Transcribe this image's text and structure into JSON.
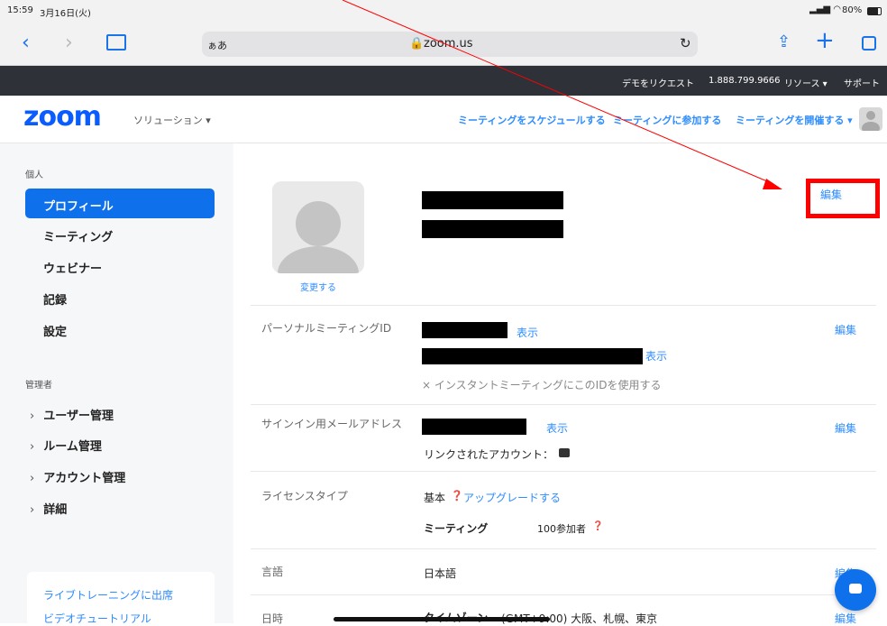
{
  "status_bar": {
    "time": "15:59",
    "date": "3月16日(火)",
    "battery": "80%"
  },
  "browser": {
    "text_size": "ぁあ",
    "url": "zoom.us"
  },
  "top_bar": {
    "request_demo": "デモをリクエスト",
    "phone": "1.888.799.9666",
    "resources": "リソース ▾",
    "support": "サポート"
  },
  "nav": {
    "logo": "zoom",
    "solutions": "ソリューション ▾",
    "schedule": "ミーティングをスケジュールする",
    "join": "ミーティングに参加する",
    "host": "ミーティングを開催する ▾"
  },
  "sidebar": {
    "personal_header": "個人",
    "items": [
      {
        "label": "プロフィール"
      },
      {
        "label": "ミーティング"
      },
      {
        "label": "ウェビナー"
      },
      {
        "label": "記録"
      },
      {
        "label": "設定"
      }
    ],
    "admin_header": "管理者",
    "admin_items": [
      {
        "label": "ユーザー管理"
      },
      {
        "label": "ルーム管理"
      },
      {
        "label": "アカウント管理"
      },
      {
        "label": "詳細"
      }
    ],
    "bottom_links": [
      {
        "label": "ライブトレーニングに出席"
      },
      {
        "label": "ビデオチュートリアル"
      }
    ]
  },
  "profile": {
    "change_photo": "変更する",
    "edit": "編集",
    "pmi": {
      "label": "パーソナルミーティングID",
      "show": "表示",
      "show2": "表示",
      "instant_option": "× インスタントミーティングにこのIDを使用する",
      "edit": "編集"
    },
    "email": {
      "label": "サインイン用メールアドレス",
      "show": "表示",
      "linked": "リンクされたアカウント：",
      "edit": "編集"
    },
    "license": {
      "label": "ライセンスタイプ",
      "type": "基本",
      "upgrade": "アップグレードする",
      "meeting_label": "ミーティング",
      "participants": "100参加者"
    },
    "language": {
      "label": "言語",
      "value": "日本語",
      "edit": "編集"
    },
    "datetime": {
      "label": "日時",
      "tz_label": "タイムゾーン",
      "tz_value": "(GMT+9:00) 大阪、札幌、東京",
      "edit": "編集"
    }
  },
  "annotation": {
    "color": "#ff0000"
  }
}
